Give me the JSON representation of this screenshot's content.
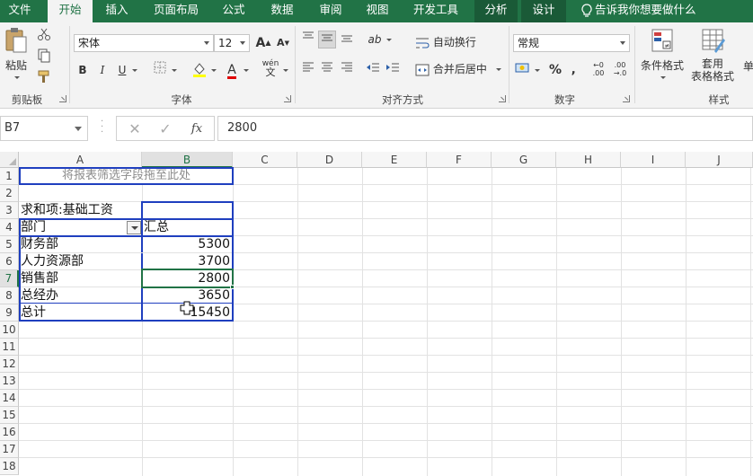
{
  "tabs": [
    {
      "label": "文件"
    },
    {
      "label": "开始"
    },
    {
      "label": "插入"
    },
    {
      "label": "页面布局"
    },
    {
      "label": "公式"
    },
    {
      "label": "数据"
    },
    {
      "label": "审阅"
    },
    {
      "label": "视图"
    },
    {
      "label": "开发工具"
    },
    {
      "label": "分析"
    },
    {
      "label": "设计"
    }
  ],
  "tell_me": "告诉我你想要做什么",
  "ribbon": {
    "clipboard": {
      "paste": "粘贴",
      "label": "剪贴板"
    },
    "font": {
      "name": "宋体",
      "size": "12",
      "bold": "B",
      "italic": "I",
      "underline": "U",
      "phonetic": "wén",
      "label": "字体"
    },
    "align": {
      "wrap": "自动换行",
      "merge": "合并后居中",
      "label": "对齐方式"
    },
    "number": {
      "format": "常规",
      "percent": "%",
      "comma": "‚",
      "label": "数字"
    },
    "styles": {
      "conditional": "条件格式",
      "table_line1": "套用",
      "table_line2": "表格格式",
      "cell": "单",
      "label": "样式"
    }
  },
  "formula_bar": {
    "name_box": "B7",
    "fx": "fx",
    "value": "2800"
  },
  "columns": [
    "A",
    "B",
    "C",
    "D",
    "E",
    "F",
    "G",
    "H",
    "I",
    "J"
  ],
  "rows": [
    "1",
    "2",
    "3",
    "4",
    "5",
    "6",
    "7",
    "8",
    "9",
    "10",
    "11",
    "12",
    "13",
    "14",
    "15",
    "16",
    "17",
    "18"
  ],
  "selected_cell": "B7",
  "sheet": {
    "drop_hint": "将报表筛选字段拖至此处",
    "sum_label": "求和项:基础工资",
    "row_header": "部门",
    "col_header": "汇总",
    "rows": [
      {
        "dept": "财务部",
        "value": "5300"
      },
      {
        "dept": "人力资源部",
        "value": "3700"
      },
      {
        "dept": "销售部",
        "value": "2800"
      },
      {
        "dept": "总经办",
        "value": "3650"
      },
      {
        "dept": "总计",
        "value": "15450"
      }
    ]
  },
  "colors": {
    "accent": "#217346",
    "pivot_border": "#1f3fbf",
    "hint_text": "#8c8c8c"
  }
}
